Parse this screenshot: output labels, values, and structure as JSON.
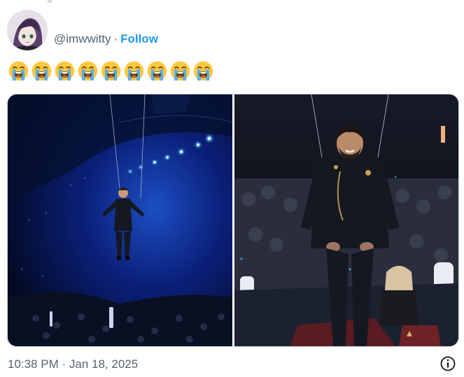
{
  "tweet": {
    "handle": "@imwwitty",
    "separator": "·",
    "follow_label": "Follow",
    "emoji_count": 9,
    "emoji_name": "loudly-crying-face",
    "media": [
      {
        "name": "left-photo",
        "scene": "performer suspended on wires above arena crowd under blue spotlights"
      },
      {
        "name": "right-photo",
        "scene": "performer in dark military-style outfit smiling in front of seated audience"
      }
    ],
    "timestamp": "10:38 PM · Jan 18, 2025"
  },
  "colors": {
    "accent": "#1d9bf0",
    "secondary_text": "#536471",
    "border": "#cfd9de",
    "emoji_face": "#FFC83D"
  }
}
